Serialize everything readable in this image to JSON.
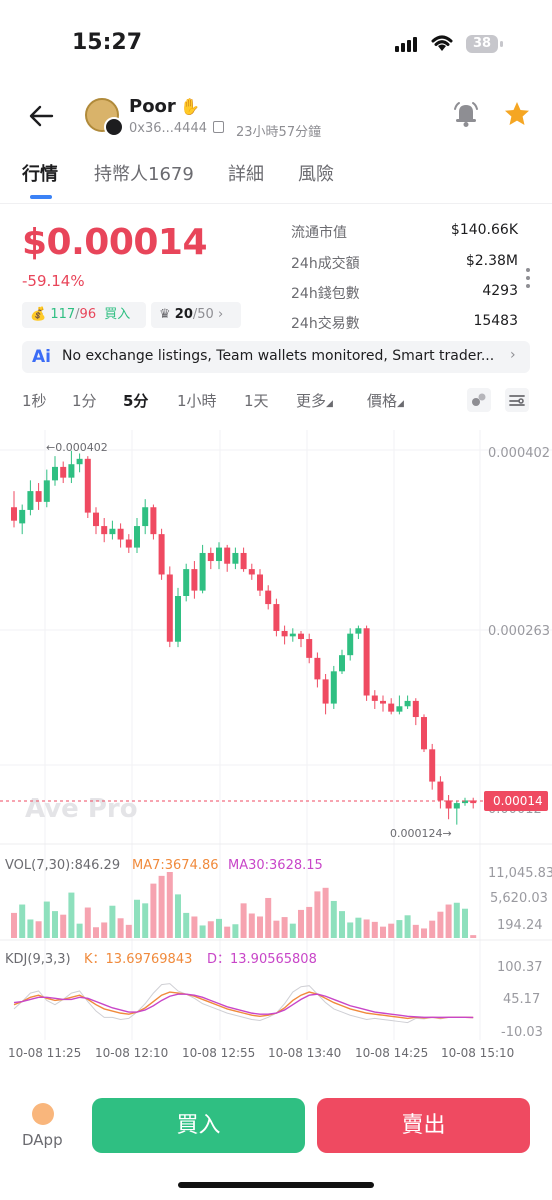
{
  "status_bar": {
    "time": "15:27",
    "battery": "38"
  },
  "token": {
    "name": "Poor",
    "address": "0x36...4444",
    "age": "23小時57分鐘"
  },
  "tabs": [
    "行情",
    "持幣人1679",
    "詳細",
    "風險"
  ],
  "price": {
    "value": "$0.00014",
    "change": "-59.14%",
    "change_color": "#e8455a"
  },
  "pills": {
    "holders_green": "117",
    "holders_sep": "/",
    "holders_red": "96",
    "buy_label": "買入",
    "rank": "20",
    "rank_total": "/50"
  },
  "stats": [
    {
      "label": "流通市值",
      "value": "$140.66K"
    },
    {
      "label": "24h成交額",
      "value": "$2.38M"
    },
    {
      "label": "24h錢包數",
      "value": "4293"
    },
    {
      "label": "24h交易數",
      "value": "15483"
    }
  ],
  "ai_banner": {
    "icon": "Ai",
    "text": "No exchange listings, Team wallets monitored, Smart trader..."
  },
  "timeframes": [
    "1秒",
    "1分",
    "5分",
    "1小時",
    "1天",
    "更多",
    "價格"
  ],
  "active_timeframe": "5分",
  "chart": {
    "watermark": "Ave Pro",
    "price_axis": [
      "0.000402",
      "0.000263",
      "0.00012"
    ],
    "high_marker": "←0.000402",
    "low_marker": "0.000124→",
    "current_price_tag": "0.00014",
    "volume_header": {
      "vol": "VOL(7,30):846.29",
      "ma7": "MA7:3674.86",
      "ma30": "MA30:3628.15"
    },
    "volume_axis": [
      "11,045.83",
      "5,620.03",
      "194.24"
    ],
    "kdj_header": {
      "name": "KDJ(9,3,3)",
      "k": "K：13.69769843",
      "d": "D：13.90565808"
    },
    "kdj_axis": [
      "100.37",
      "45.17",
      "-10.03"
    ],
    "time_axis": [
      "10-08 11:25",
      "10-08 12:10",
      "10-08 12:55",
      "10-08 13:40",
      "10-08 14:25",
      "10-08 15:10"
    ]
  },
  "chart_data": {
    "type": "candlestick",
    "note": "5-minute candles, price in units of 0.000001",
    "candles": [
      [
        360,
        350,
        372,
        345
      ],
      [
        348,
        358,
        362,
        340
      ],
      [
        358,
        372,
        380,
        354
      ],
      [
        372,
        364,
        378,
        358
      ],
      [
        364,
        380,
        388,
        360
      ],
      [
        380,
        390,
        398,
        376
      ],
      [
        390,
        382,
        394,
        378
      ],
      [
        382,
        392,
        402,
        378
      ],
      [
        392,
        396,
        400,
        386
      ],
      [
        396,
        356,
        398,
        352
      ],
      [
        356,
        346,
        360,
        340
      ],
      [
        346,
        340,
        352,
        334
      ],
      [
        340,
        344,
        350,
        336
      ],
      [
        344,
        336,
        348,
        330
      ],
      [
        336,
        330,
        340,
        326
      ],
      [
        330,
        346,
        352,
        326
      ],
      [
        346,
        360,
        366,
        340
      ],
      [
        360,
        340,
        362,
        336
      ],
      [
        340,
        310,
        344,
        306
      ],
      [
        310,
        260,
        316,
        256
      ],
      [
        260,
        294,
        300,
        256
      ],
      [
        294,
        314,
        318,
        290
      ],
      [
        314,
        298,
        320,
        292
      ],
      [
        298,
        326,
        332,
        296
      ],
      [
        326,
        320,
        330,
        314
      ],
      [
        320,
        330,
        334,
        314
      ],
      [
        330,
        318,
        332,
        312
      ],
      [
        318,
        326,
        330,
        314
      ],
      [
        326,
        314,
        330,
        312
      ],
      [
        314,
        310,
        318,
        306
      ],
      [
        310,
        298,
        314,
        294
      ],
      [
        298,
        288,
        302,
        284
      ],
      [
        288,
        268,
        292,
        264
      ],
      [
        268,
        264,
        272,
        258
      ],
      [
        264,
        266,
        270,
        260
      ],
      [
        266,
        262,
        268,
        256
      ],
      [
        262,
        248,
        266,
        244
      ],
      [
        248,
        232,
        252,
        226
      ],
      [
        232,
        214,
        236,
        206
      ],
      [
        214,
        238,
        242,
        210
      ],
      [
        238,
        250,
        254,
        236
      ],
      [
        250,
        266,
        270,
        246
      ],
      [
        266,
        270,
        272,
        262
      ],
      [
        270,
        220,
        272,
        216
      ],
      [
        220,
        216,
        224,
        210
      ],
      [
        216,
        214,
        220,
        208
      ],
      [
        214,
        208,
        218,
        206
      ],
      [
        208,
        212,
        220,
        206
      ],
      [
        212,
        216,
        220,
        210
      ],
      [
        216,
        204,
        218,
        198
      ],
      [
        204,
        180,
        206,
        178
      ],
      [
        180,
        156,
        184,
        150
      ],
      [
        156,
        142,
        160,
        136
      ],
      [
        142,
        136,
        146,
        128
      ],
      [
        136,
        140,
        142,
        124
      ],
      [
        140,
        142,
        144,
        138
      ],
      [
        142,
        140,
        144,
        136
      ]
    ],
    "volume": [
      4200,
      5600,
      3100,
      2800,
      6100,
      4500,
      3900,
      7600,
      2400,
      5100,
      1800,
      2600,
      5400,
      3300,
      2200,
      6400,
      5800,
      9100,
      10400,
      11045,
      7300,
      4200,
      3600,
      2100,
      2800,
      3200,
      1900,
      2300,
      5800,
      4100,
      3600,
      6700,
      2900,
      3500,
      2400,
      4700,
      5200,
      7800,
      8400,
      6200,
      4500,
      2600,
      3400,
      3100,
      2700,
      1900,
      2400,
      3000,
      3800,
      2200,
      1600,
      2900,
      4400,
      5600,
      5900,
      4900,
      480
    ],
    "kdj_k": [
      38,
      44,
      52,
      56,
      50,
      46,
      48,
      52,
      56,
      48,
      38,
      30,
      26,
      22,
      20,
      24,
      32,
      44,
      56,
      62,
      60,
      58,
      54,
      48,
      42,
      36,
      30,
      26,
      22,
      18,
      16,
      18,
      22,
      32,
      46,
      56,
      62,
      58,
      50,
      42,
      36,
      30,
      26,
      22,
      20,
      18,
      16,
      14,
      12,
      14,
      13,
      14,
      13,
      14,
      14,
      14,
      13.7
    ],
    "kdj_d": [
      42,
      44,
      48,
      52,
      52,
      50,
      48,
      48,
      52,
      50,
      44,
      38,
      32,
      28,
      24,
      24,
      28,
      36,
      46,
      54,
      58,
      58,
      56,
      52,
      46,
      40,
      34,
      30,
      26,
      22,
      20,
      20,
      22,
      28,
      38,
      48,
      56,
      58,
      54,
      48,
      42,
      36,
      32,
      28,
      24,
      22,
      20,
      18,
      16,
      15,
      14,
      14,
      14,
      14,
      14,
      14,
      13.9
    ],
    "ylim": [
      120,
      410
    ],
    "x_ticks": [
      "10-08 11:25",
      "10-08 12:10",
      "10-08 12:55",
      "10-08 13:40",
      "10-08 14:25",
      "10-08 15:10"
    ]
  },
  "actions": {
    "dapp": "DApp",
    "buy": "買入",
    "sell": "賣出"
  },
  "colors": {
    "up": "#2fbf82",
    "down": "#ef4a61",
    "accent": "#3b82f6",
    "star": "#f5a623"
  }
}
